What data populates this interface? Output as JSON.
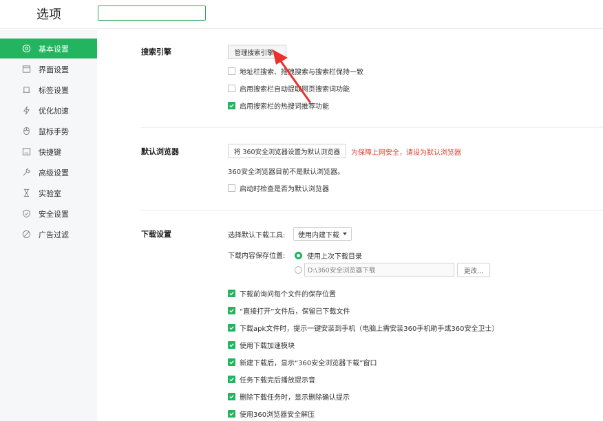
{
  "header": {
    "title": "选项",
    "search_value": ""
  },
  "sidebar": {
    "items": [
      {
        "label": "基本设置",
        "icon": "target-icon",
        "active": true
      },
      {
        "label": "界面设置",
        "icon": "window-icon",
        "active": false
      },
      {
        "label": "标签设置",
        "icon": "tab-icon",
        "active": false
      },
      {
        "label": "优化加速",
        "icon": "lightning-icon",
        "active": false
      },
      {
        "label": "鼠标手势",
        "icon": "mouse-icon",
        "active": false
      },
      {
        "label": "快捷键",
        "icon": "keyboard-icon",
        "active": false
      },
      {
        "label": "高级设置",
        "icon": "wrench-icon",
        "active": false
      },
      {
        "label": "实验室",
        "icon": "flask-icon",
        "active": false
      },
      {
        "label": "安全设置",
        "icon": "shield-icon",
        "active": false
      },
      {
        "label": "广告过滤",
        "icon": "block-icon",
        "active": false
      }
    ]
  },
  "search_engine": {
    "title": "搜索引擎",
    "manage_button": "管理搜索引擎...",
    "options": [
      {
        "label": "地址栏搜索、拖拽搜索与搜索栏保持一致",
        "checked": false
      },
      {
        "label": "启用搜索栏自动提取网页搜索词功能",
        "checked": false
      },
      {
        "label": "启用搜索栏的热搜词推荐功能",
        "checked": true
      }
    ]
  },
  "default_browser": {
    "title": "默认浏览器",
    "set_button": "将 360安全浏览器设置为默认浏览器",
    "warning": "为保障上网安全，请设为默认浏览器",
    "status": "360安全浏览器目前不是默认浏览器。",
    "startup_check": {
      "label": "启动时检查是否为默认浏览器",
      "checked": false
    }
  },
  "download": {
    "title": "下载设置",
    "tool_label": "选择默认下载工具:",
    "tool_value": "使用内建下载",
    "location_label": "下载内容保存位置:",
    "location_option_last": "使用上次下载目录",
    "location_path": "D:\\360安全浏览器下载",
    "change_button": "更改...",
    "options": [
      {
        "label": "下载前询问每个文件的保存位置",
        "checked": true
      },
      {
        "label": "“直接打开”文件后，保留已下载文件",
        "checked": true
      },
      {
        "label": "下载apk文件时，提示一键安装到手机（电脑上需安装360手机助手或360安全卫士）",
        "checked": true
      },
      {
        "label": "使用下载加速模块",
        "checked": true
      },
      {
        "label": "新建下载后，显示“360安全浏览器下载”窗口",
        "checked": true
      },
      {
        "label": "任务下载完后播放提示音",
        "checked": true
      },
      {
        "label": "删除下载任务时，显示删除确认提示",
        "checked": true
      },
      {
        "label": "使用360浏览器安全解压",
        "checked": true
      }
    ]
  },
  "colors": {
    "accent": "#22b45f",
    "warning": "#e43b2c",
    "arrow": "#e8322b"
  }
}
